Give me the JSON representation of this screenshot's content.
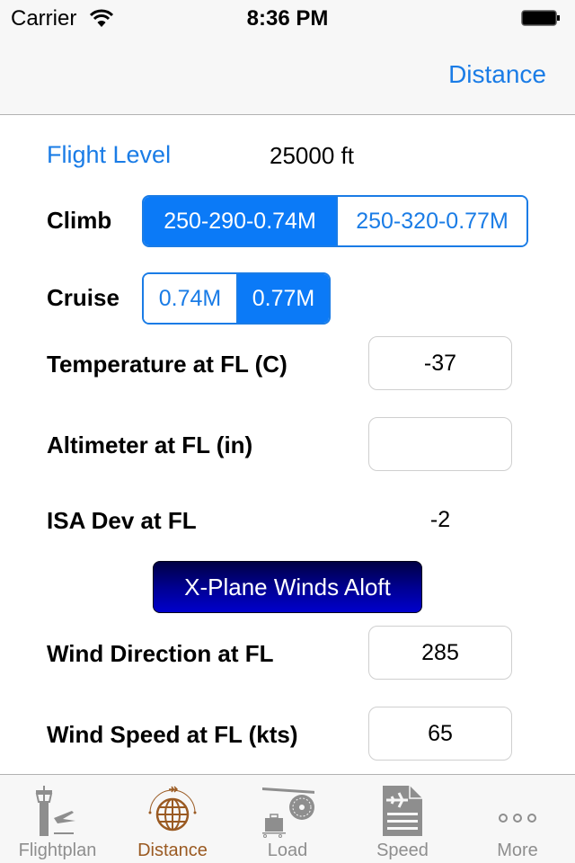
{
  "status_bar": {
    "carrier": "Carrier",
    "time": "8:36 PM",
    "wifi_icon": "wifi-icon",
    "battery_icon": "battery-icon"
  },
  "nav_bar": {
    "right_button": "Distance"
  },
  "form": {
    "flight_level": {
      "label": "Flight Level",
      "value": "25000 ft"
    },
    "climb": {
      "label": "Climb",
      "options": [
        "250-290-0.74M",
        "250-320-0.77M"
      ],
      "selected_index": 0
    },
    "cruise": {
      "label": "Cruise",
      "options": [
        "0.74M",
        "0.77M"
      ],
      "selected_index": 1
    },
    "temperature": {
      "label": "Temperature at FL (C)",
      "value": "-37",
      "placeholder": ""
    },
    "altimeter": {
      "label": "Altimeter at FL (in)",
      "value": "",
      "placeholder": ""
    },
    "isa_dev": {
      "label": "ISA Dev at FL",
      "value": "-2"
    },
    "xplane_button": "X-Plane Winds Aloft",
    "wind_direction": {
      "label": "Wind Direction at FL",
      "value": "285",
      "placeholder": ""
    },
    "wind_speed": {
      "label": "Wind Speed at FL (kts)",
      "value": "65",
      "placeholder": ""
    }
  },
  "tab_bar": {
    "items": [
      {
        "label": "Flightplan",
        "icon": "control-tower-departure-icon",
        "active": false
      },
      {
        "label": "Distance",
        "icon": "globe-flight-path-icon",
        "active": true
      },
      {
        "label": "Load",
        "icon": "baggage-engine-icon",
        "active": false
      },
      {
        "label": "Speed",
        "icon": "flight-document-icon",
        "active": false
      },
      {
        "label": "More",
        "icon": "more-dots-icon",
        "active": false
      }
    ]
  },
  "colors": {
    "accent": "#1a7ce6",
    "segment_selected": "#0b7af7",
    "tab_active": "#9a5a22",
    "tab_inactive": "#8e8e8e",
    "xplane_button": "#0000aa"
  }
}
